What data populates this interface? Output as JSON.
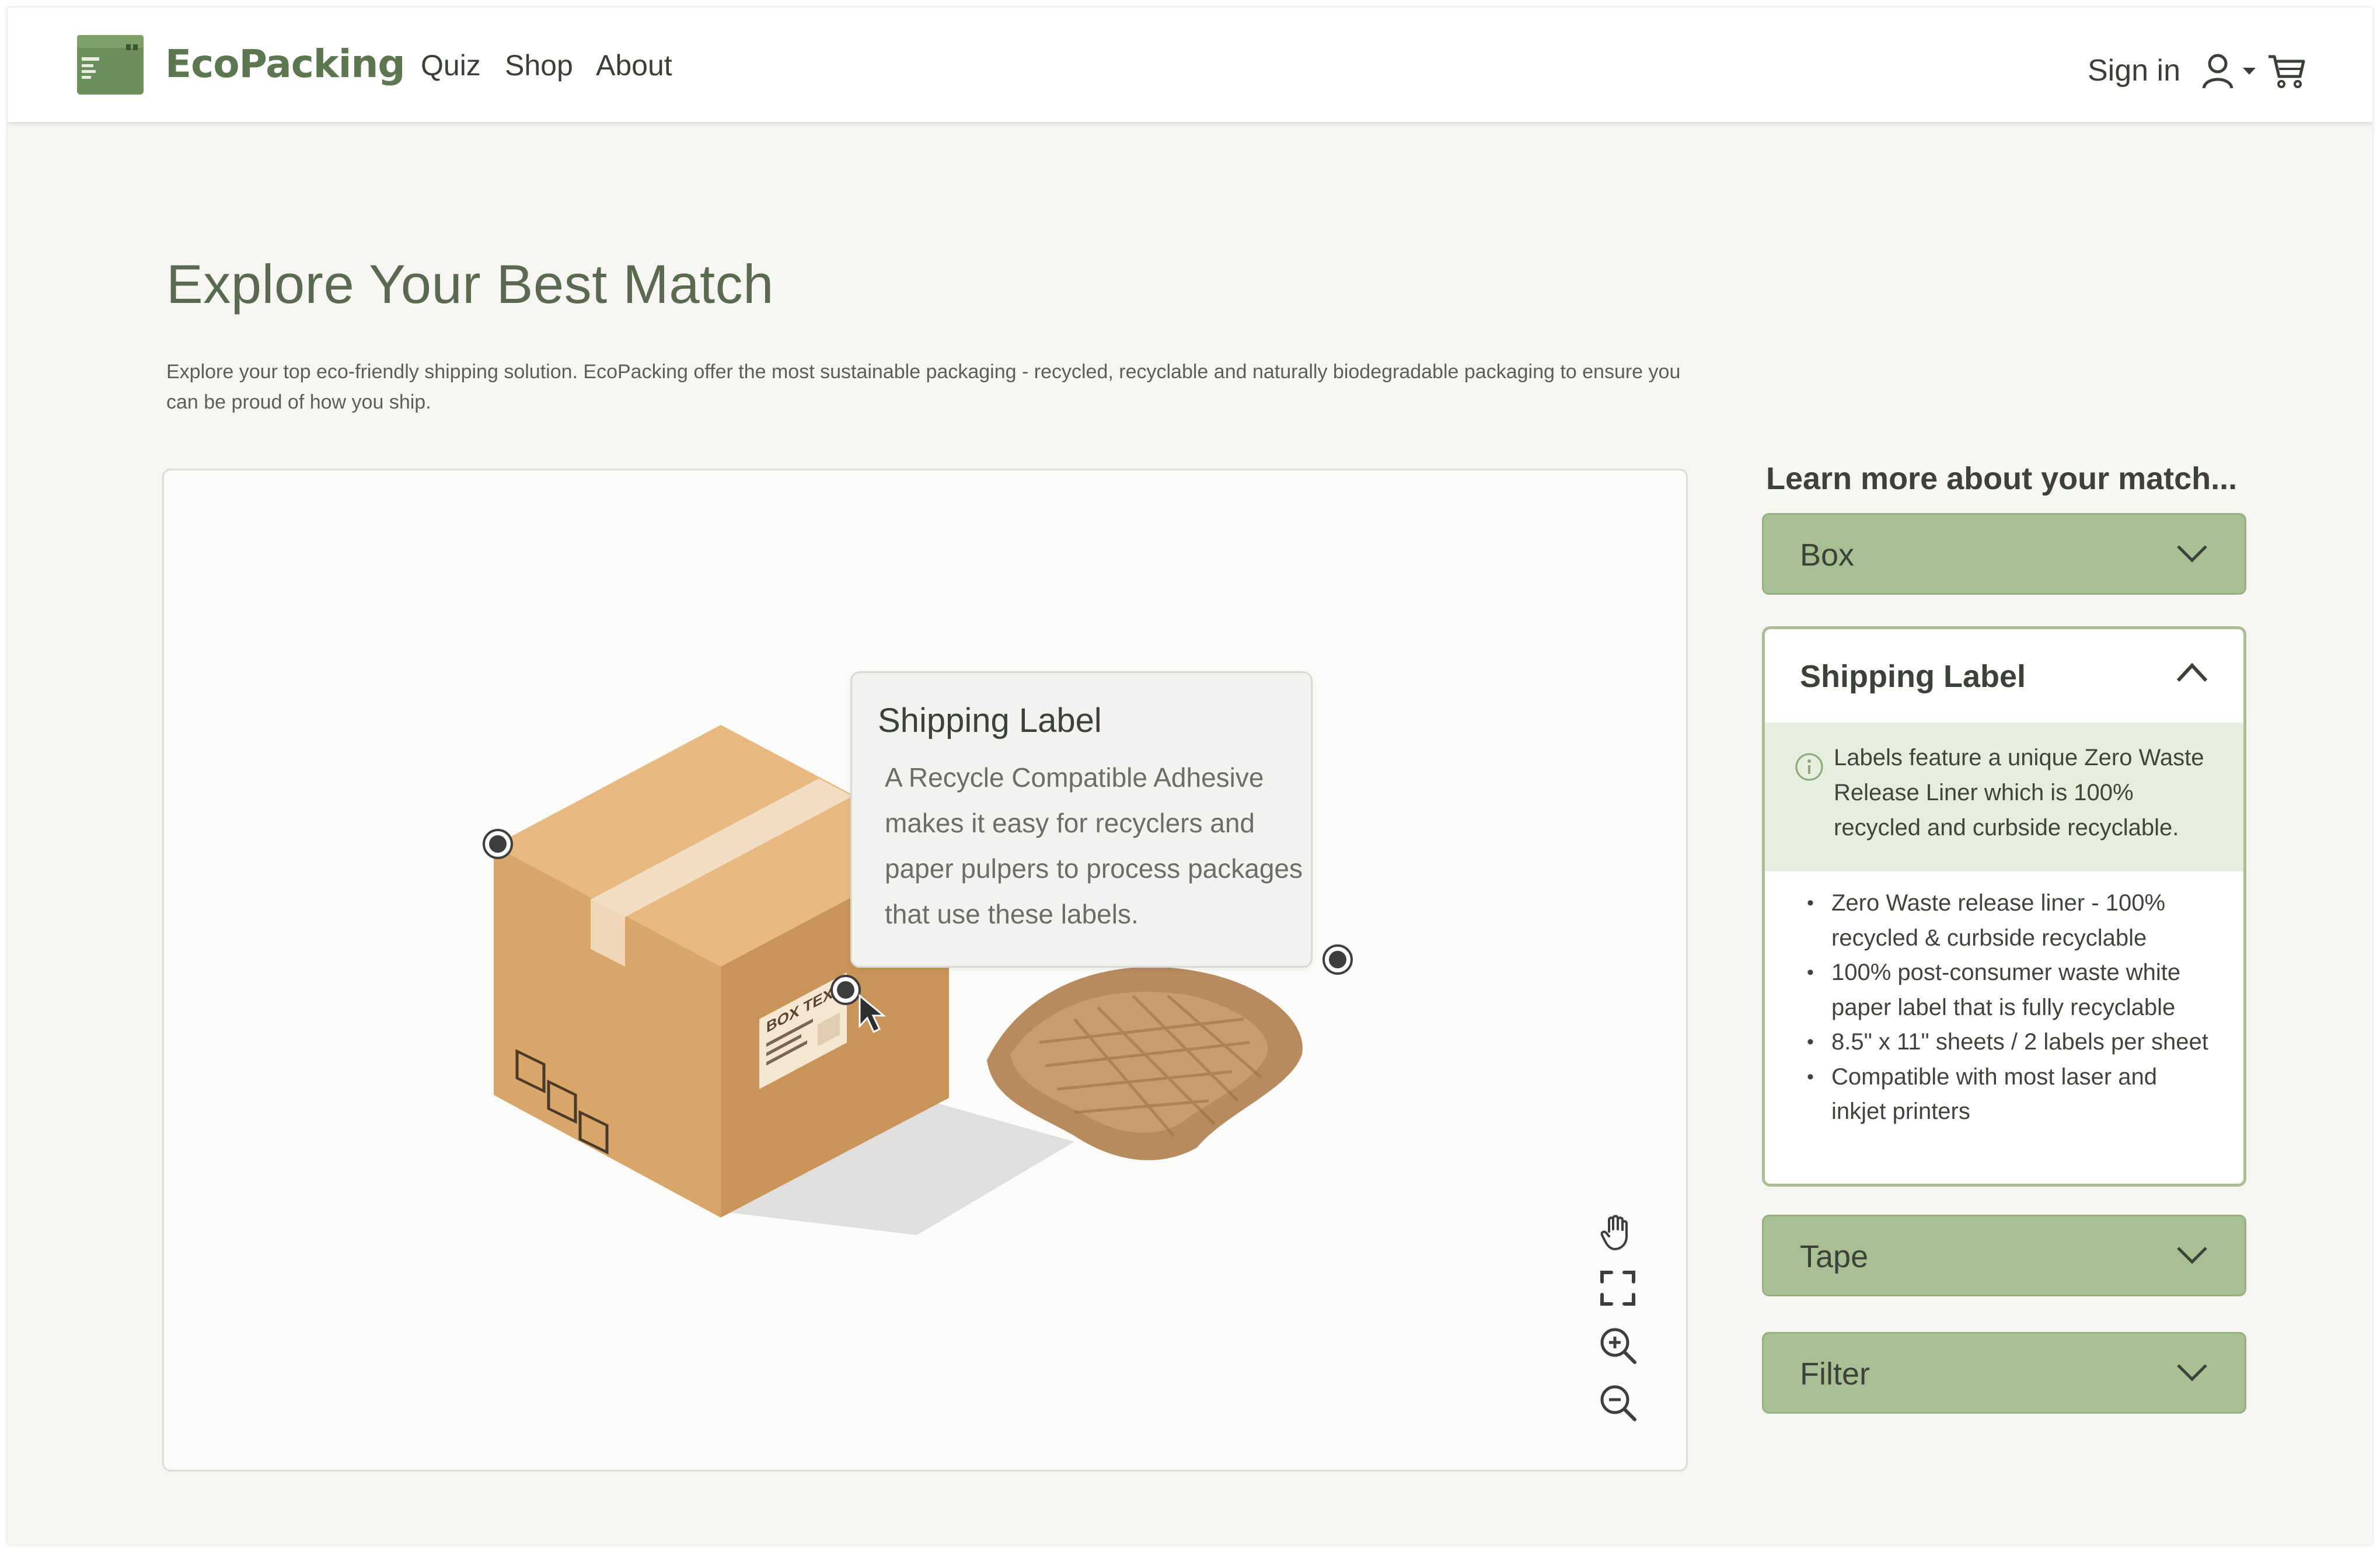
{
  "header": {
    "brand": "EcoPacking",
    "nav": [
      "Quiz",
      "Shop",
      "About"
    ],
    "sign_in": "Sign in"
  },
  "main": {
    "title": "Explore Your Best Match",
    "intro": "Explore your top eco-friendly shipping solution. EcoPacking offer the most sustainable packaging - recycled, recyclable and naturally biodegradable packaging to ensure you can be proud of how you ship."
  },
  "viewer": {
    "tooltip": {
      "title": "Shipping Label",
      "body": "A Recycle Compatible Adhesive makes it easy for recyclers and paper pulpers to process packages that use these labels."
    },
    "box_label_text": "BOX TEXT",
    "tools": [
      "hand-icon",
      "fullscreen-icon",
      "zoom-in-icon",
      "zoom-out-icon"
    ]
  },
  "side": {
    "heading": "Learn more about your match...",
    "accordions": {
      "box": "Box",
      "shipping_label": "Shipping Label",
      "tape": "Tape",
      "filter": "Filter"
    },
    "shipping_label": {
      "info": "Labels feature a unique Zero Waste Release Liner which is 100% recycled and curbside recyclable.",
      "bullets": [
        "Zero Waste release liner - 100% recycled & curbside recyclable",
        "100% post-consumer waste white paper label that is fully recyclable",
        "8.5\" x 11\" sheets / 2 labels per sheet",
        "Compatible with most laser and inkjet printers"
      ]
    }
  },
  "colors": {
    "brand_green": "#5d7750",
    "accordion_green": "#a7bf92",
    "info_band": "#e5eedd",
    "background": "#f6f5f2"
  }
}
